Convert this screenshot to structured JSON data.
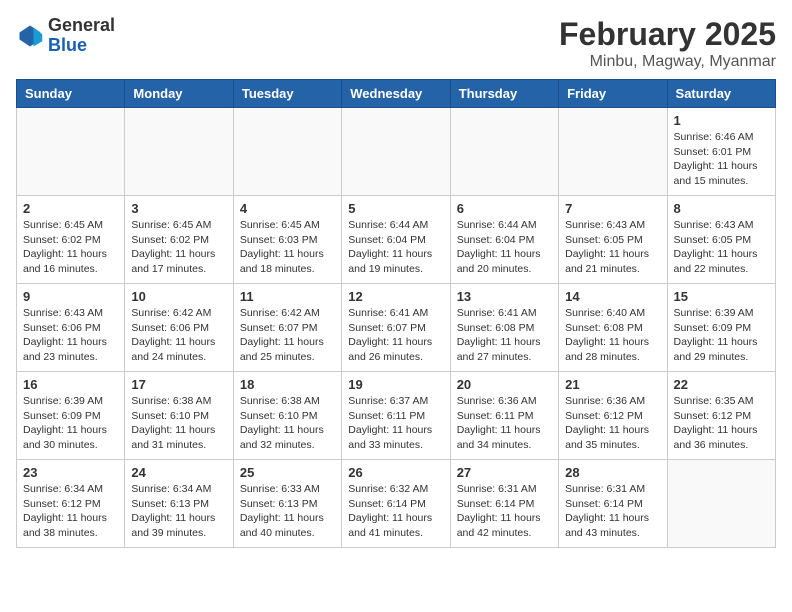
{
  "header": {
    "logo_general": "General",
    "logo_blue": "Blue",
    "month_title": "February 2025",
    "location": "Minbu, Magway, Myanmar"
  },
  "weekdays": [
    "Sunday",
    "Monday",
    "Tuesday",
    "Wednesday",
    "Thursday",
    "Friday",
    "Saturday"
  ],
  "weeks": [
    [
      {
        "day": "",
        "info": ""
      },
      {
        "day": "",
        "info": ""
      },
      {
        "day": "",
        "info": ""
      },
      {
        "day": "",
        "info": ""
      },
      {
        "day": "",
        "info": ""
      },
      {
        "day": "",
        "info": ""
      },
      {
        "day": "1",
        "info": "Sunrise: 6:46 AM\nSunset: 6:01 PM\nDaylight: 11 hours\nand 15 minutes."
      }
    ],
    [
      {
        "day": "2",
        "info": "Sunrise: 6:45 AM\nSunset: 6:02 PM\nDaylight: 11 hours\nand 16 minutes."
      },
      {
        "day": "3",
        "info": "Sunrise: 6:45 AM\nSunset: 6:02 PM\nDaylight: 11 hours\nand 17 minutes."
      },
      {
        "day": "4",
        "info": "Sunrise: 6:45 AM\nSunset: 6:03 PM\nDaylight: 11 hours\nand 18 minutes."
      },
      {
        "day": "5",
        "info": "Sunrise: 6:44 AM\nSunset: 6:04 PM\nDaylight: 11 hours\nand 19 minutes."
      },
      {
        "day": "6",
        "info": "Sunrise: 6:44 AM\nSunset: 6:04 PM\nDaylight: 11 hours\nand 20 minutes."
      },
      {
        "day": "7",
        "info": "Sunrise: 6:43 AM\nSunset: 6:05 PM\nDaylight: 11 hours\nand 21 minutes."
      },
      {
        "day": "8",
        "info": "Sunrise: 6:43 AM\nSunset: 6:05 PM\nDaylight: 11 hours\nand 22 minutes."
      }
    ],
    [
      {
        "day": "9",
        "info": "Sunrise: 6:43 AM\nSunset: 6:06 PM\nDaylight: 11 hours\nand 23 minutes."
      },
      {
        "day": "10",
        "info": "Sunrise: 6:42 AM\nSunset: 6:06 PM\nDaylight: 11 hours\nand 24 minutes."
      },
      {
        "day": "11",
        "info": "Sunrise: 6:42 AM\nSunset: 6:07 PM\nDaylight: 11 hours\nand 25 minutes."
      },
      {
        "day": "12",
        "info": "Sunrise: 6:41 AM\nSunset: 6:07 PM\nDaylight: 11 hours\nand 26 minutes."
      },
      {
        "day": "13",
        "info": "Sunrise: 6:41 AM\nSunset: 6:08 PM\nDaylight: 11 hours\nand 27 minutes."
      },
      {
        "day": "14",
        "info": "Sunrise: 6:40 AM\nSunset: 6:08 PM\nDaylight: 11 hours\nand 28 minutes."
      },
      {
        "day": "15",
        "info": "Sunrise: 6:39 AM\nSunset: 6:09 PM\nDaylight: 11 hours\nand 29 minutes."
      }
    ],
    [
      {
        "day": "16",
        "info": "Sunrise: 6:39 AM\nSunset: 6:09 PM\nDaylight: 11 hours\nand 30 minutes."
      },
      {
        "day": "17",
        "info": "Sunrise: 6:38 AM\nSunset: 6:10 PM\nDaylight: 11 hours\nand 31 minutes."
      },
      {
        "day": "18",
        "info": "Sunrise: 6:38 AM\nSunset: 6:10 PM\nDaylight: 11 hours\nand 32 minutes."
      },
      {
        "day": "19",
        "info": "Sunrise: 6:37 AM\nSunset: 6:11 PM\nDaylight: 11 hours\nand 33 minutes."
      },
      {
        "day": "20",
        "info": "Sunrise: 6:36 AM\nSunset: 6:11 PM\nDaylight: 11 hours\nand 34 minutes."
      },
      {
        "day": "21",
        "info": "Sunrise: 6:36 AM\nSunset: 6:12 PM\nDaylight: 11 hours\nand 35 minutes."
      },
      {
        "day": "22",
        "info": "Sunrise: 6:35 AM\nSunset: 6:12 PM\nDaylight: 11 hours\nand 36 minutes."
      }
    ],
    [
      {
        "day": "23",
        "info": "Sunrise: 6:34 AM\nSunset: 6:12 PM\nDaylight: 11 hours\nand 38 minutes."
      },
      {
        "day": "24",
        "info": "Sunrise: 6:34 AM\nSunset: 6:13 PM\nDaylight: 11 hours\nand 39 minutes."
      },
      {
        "day": "25",
        "info": "Sunrise: 6:33 AM\nSunset: 6:13 PM\nDaylight: 11 hours\nand 40 minutes."
      },
      {
        "day": "26",
        "info": "Sunrise: 6:32 AM\nSunset: 6:14 PM\nDaylight: 11 hours\nand 41 minutes."
      },
      {
        "day": "27",
        "info": "Sunrise: 6:31 AM\nSunset: 6:14 PM\nDaylight: 11 hours\nand 42 minutes."
      },
      {
        "day": "28",
        "info": "Sunrise: 6:31 AM\nSunset: 6:14 PM\nDaylight: 11 hours\nand 43 minutes."
      },
      {
        "day": "",
        "info": ""
      }
    ]
  ]
}
